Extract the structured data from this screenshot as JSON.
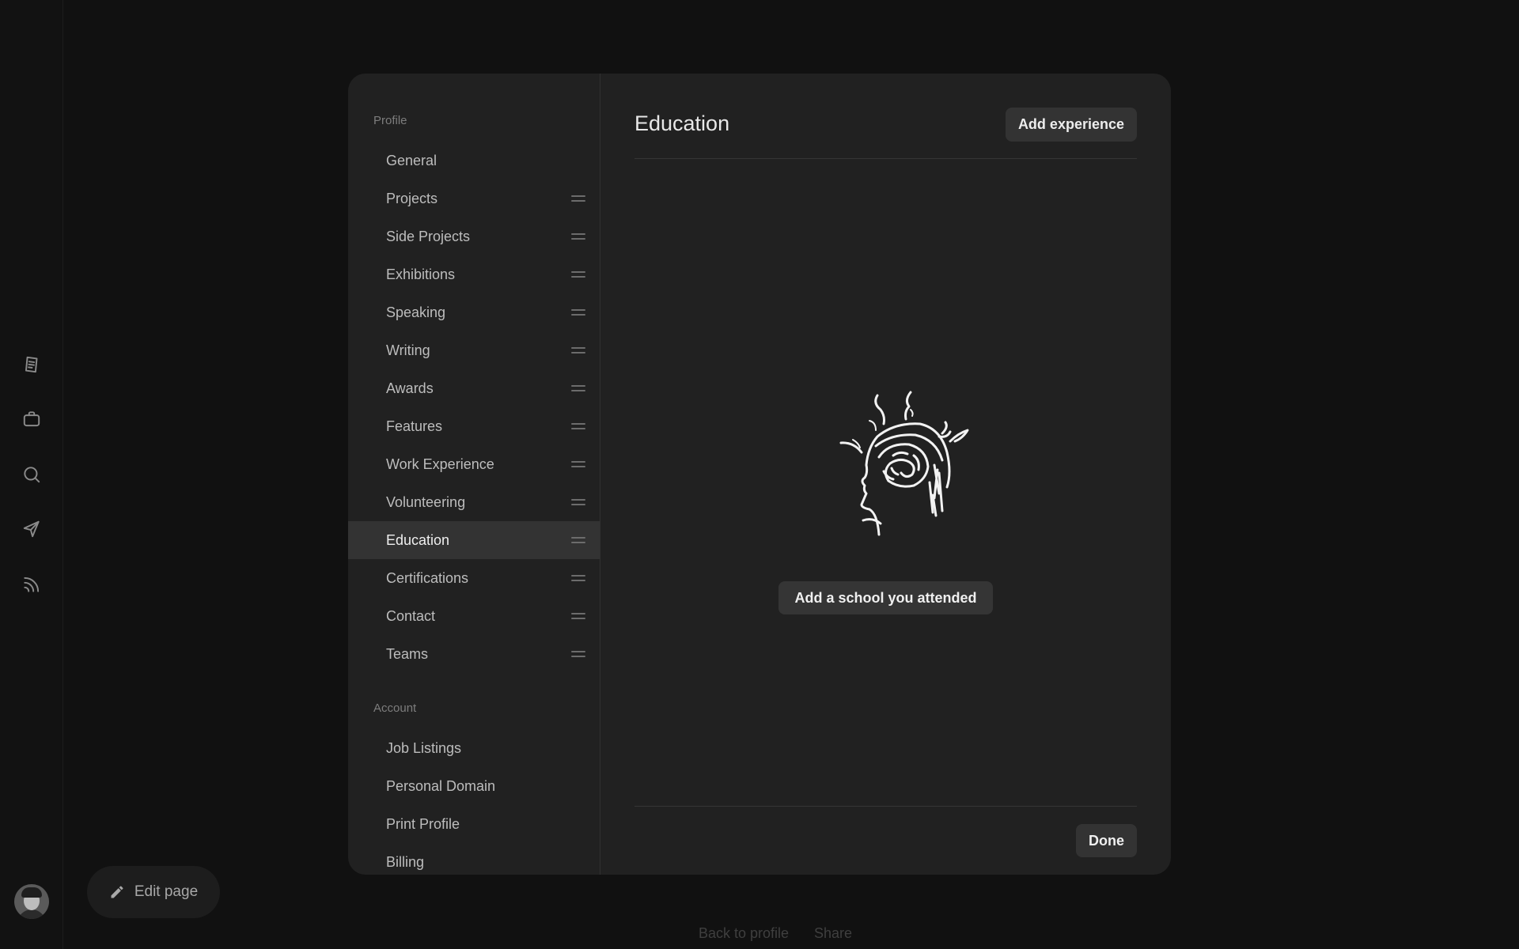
{
  "rail": {
    "icons": [
      "notes-icon",
      "briefcase-icon",
      "search-icon",
      "send-icon",
      "feed-icon"
    ]
  },
  "edit_page": {
    "label": "Edit page",
    "icon": "pencil-icon"
  },
  "footer": {
    "back_label": "Back to profile",
    "share_label": "Share"
  },
  "nav": {
    "profile_heading": "Profile",
    "profile_items": [
      {
        "label": "General",
        "draggable": false
      },
      {
        "label": "Projects",
        "draggable": true
      },
      {
        "label": "Side Projects",
        "draggable": true
      },
      {
        "label": "Exhibitions",
        "draggable": true
      },
      {
        "label": "Speaking",
        "draggable": true
      },
      {
        "label": "Writing",
        "draggable": true
      },
      {
        "label": "Awards",
        "draggable": true
      },
      {
        "label": "Features",
        "draggable": true
      },
      {
        "label": "Work Experience",
        "draggable": true
      },
      {
        "label": "Volunteering",
        "draggable": true
      },
      {
        "label": "Education",
        "draggable": true,
        "active": true
      },
      {
        "label": "Certifications",
        "draggable": true
      },
      {
        "label": "Contact",
        "draggable": true
      },
      {
        "label": "Teams",
        "draggable": true
      }
    ],
    "account_heading": "Account",
    "account_items": [
      {
        "label": "Job Listings"
      },
      {
        "label": "Personal Domain"
      },
      {
        "label": "Print Profile"
      },
      {
        "label": "Billing"
      }
    ]
  },
  "content": {
    "title": "Education",
    "add_experience_label": "Add experience",
    "empty_state_label": "Add a school you attended",
    "done_label": "Done"
  },
  "colors": {
    "background": "#111111",
    "modal": "#212121",
    "active_item": "#333333",
    "button": "#333333"
  }
}
